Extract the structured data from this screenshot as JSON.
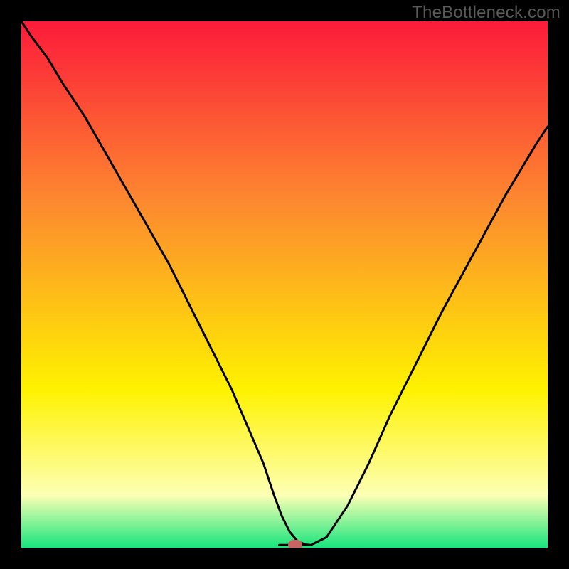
{
  "watermark": "TheBottleneck.com",
  "colors": {
    "frame": "#000000",
    "watermark_text": "#5a5a5a",
    "marker": "#c86462",
    "curve": "#000000",
    "gradient_top": "#fc1b3a",
    "gradient_mid1": "#fd8b2f",
    "gradient_mid2": "#fef200",
    "gradient_band": "#fdffb4",
    "gradient_bottom": "#17e57d"
  },
  "chart_data": {
    "type": "line",
    "title": "",
    "xlabel": "",
    "ylabel": "",
    "xlim": [
      0,
      100
    ],
    "ylim": [
      0,
      100
    ],
    "curve": {
      "name": "bottleneck-curve",
      "x": [
        0,
        2,
        5,
        8,
        12,
        16,
        20,
        24,
        28,
        32,
        36,
        40,
        43,
        46,
        48,
        49.5,
        51,
        52.5,
        54,
        55,
        58,
        62,
        66,
        70,
        75,
        80,
        86,
        92,
        98,
        100
      ],
      "y": [
        100,
        97,
        93,
        88,
        82,
        75,
        68,
        61,
        54,
        46,
        38,
        30,
        23,
        16,
        10,
        6,
        3,
        1.2,
        0.6,
        0.5,
        2,
        8,
        16,
        25,
        35,
        45,
        56,
        67,
        77,
        80
      ]
    },
    "flat_bottom": {
      "x_start": 49,
      "x_end": 54,
      "y": 0.5
    },
    "marker": {
      "x": 52,
      "y": 0.5
    }
  }
}
